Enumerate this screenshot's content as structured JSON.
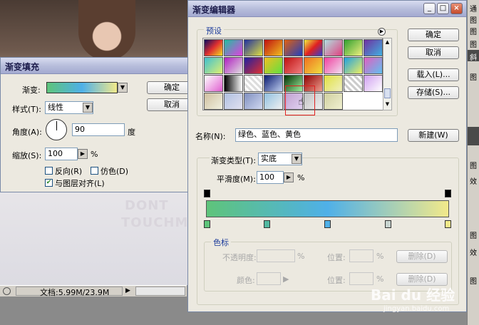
{
  "background": {
    "watermark_line1": "DONT",
    "watermark_line2": "TOUCHM"
  },
  "status_bar": {
    "doc_info": "文档:5.99M/23.9M"
  },
  "right_panel": {
    "items": [
      "通",
      "图",
      "图",
      "图",
      "图",
      "斜",
      "图",
      "效",
      "图",
      "效",
      "图"
    ]
  },
  "fill_dialog": {
    "title": "渐变填充",
    "gradient_label": "渐变:",
    "style_label": "样式(T):",
    "style_value": "线性",
    "angle_label": "角度(A):",
    "angle_value": "90",
    "angle_unit": "度",
    "scale_label": "缩放(S):",
    "scale_value": "100",
    "scale_unit": "%",
    "reverse_label": "反向(R)",
    "dither_label": "仿色(D)",
    "align_label": "与图层对齐(L)",
    "align_checked": true,
    "ok_label": "确定",
    "cancel_label": "取消"
  },
  "editor": {
    "title": "渐变编辑器",
    "presets_label": "预设",
    "ok_label": "确定",
    "cancel_label": "取消",
    "load_label": "载入(L)...",
    "save_label": "存储(S)...",
    "name_label": "名称(N):",
    "name_value": "绿色、蓝色、黄色",
    "new_label": "新建(W)",
    "type_label": "渐变类型(T):",
    "type_value": "实底",
    "smooth_label": "平滑度(M):",
    "smooth_value": "100",
    "smooth_unit": "%",
    "color_stops_label": "色标",
    "opacity_label": "不透明度:",
    "opacity_unit": "%",
    "location_label": "位置:",
    "location_unit": "%",
    "delete_label": "删除(D)",
    "color_label": "颜色:",
    "delete2_label": "删除(D)",
    "gradient_colors": [
      "#5ec47a",
      "#4fb0e8",
      "#f2e98a"
    ]
  },
  "watermark": {
    "text": "Bai du 经验",
    "url": "jingyan.baidu.com"
  }
}
